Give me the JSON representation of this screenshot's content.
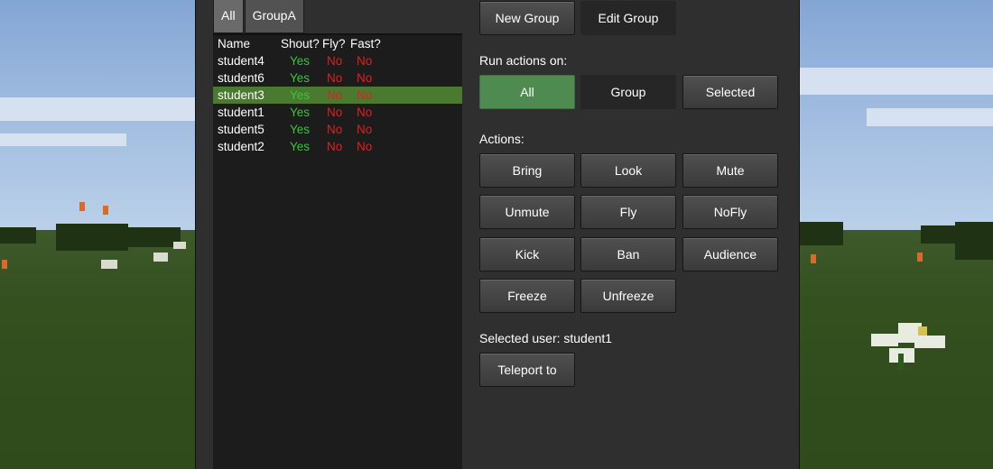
{
  "tabs": [
    "All",
    "GroupA"
  ],
  "list": {
    "headers": {
      "name": "Name",
      "shout": "Shout?",
      "fly": "Fly?",
      "fast": "Fast?"
    },
    "rows": [
      {
        "name": "student4",
        "shout": "Yes",
        "fly": "No",
        "fast": "No",
        "selected": false
      },
      {
        "name": "student6",
        "shout": "Yes",
        "fly": "No",
        "fast": "No",
        "selected": false
      },
      {
        "name": "student3",
        "shout": "Yes",
        "fly": "No",
        "fast": "No",
        "selected": true
      },
      {
        "name": "student1",
        "shout": "Yes",
        "fly": "No",
        "fast": "No",
        "selected": false
      },
      {
        "name": "student5",
        "shout": "Yes",
        "fly": "No",
        "fast": "No",
        "selected": false
      },
      {
        "name": "student2",
        "shout": "Yes",
        "fly": "No",
        "fast": "No",
        "selected": false
      }
    ]
  },
  "group_buttons": {
    "new_group": "New Group",
    "edit_group": "Edit Group"
  },
  "run_on": {
    "label": "Run actions on:",
    "all": "All",
    "group": "Group",
    "selected": "Selected"
  },
  "actions": {
    "label": "Actions:",
    "bring": "Bring",
    "look": "Look",
    "mute": "Mute",
    "unmute": "Unmute",
    "fly": "Fly",
    "nofly": "NoFly",
    "kick": "Kick",
    "ban": "Ban",
    "audience": "Audience",
    "freeze": "Freeze",
    "unfreeze": "Unfreeze"
  },
  "selected_user": {
    "label": "Selected user: student1",
    "teleport": "Teleport to"
  },
  "colors": {
    "selected_row": "#4a7a30",
    "yes": "#3cc33c",
    "no": "#e02020",
    "active_toggle": "#4f8a50"
  }
}
